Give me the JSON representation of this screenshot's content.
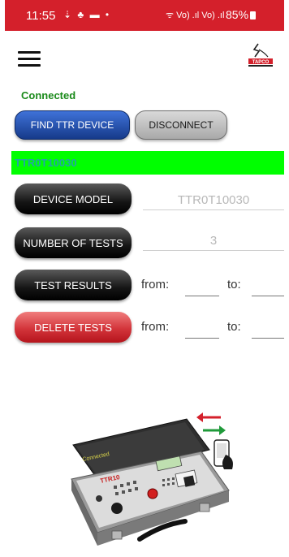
{
  "status_bar": {
    "time": "11:55",
    "notification_icons": "⇣ ♣ ▬ •",
    "signal_text": "ᯤ Vo) .ıl Vo) .ıl",
    "battery_text": "85%"
  },
  "app": {
    "connection_status": "Connected",
    "find_button_label": "FIND TTR DEVICE",
    "disconnect_button_label": "DISCONNECT",
    "device_id_banner": "TTR0T10030",
    "logo_text": "TAPCO"
  },
  "rows": {
    "device_model": {
      "label": "DEVICE MODEL",
      "value": "TTR0T10030"
    },
    "number_of_tests": {
      "label": "NUMBER OF TESTS",
      "value": "3"
    },
    "test_results": {
      "label": "TEST RESULTS",
      "from_label": "from:",
      "to_label": "to:"
    },
    "delete_tests": {
      "label": "DELETE TESTS",
      "from_label": "from:",
      "to_label": "to:"
    }
  },
  "illustration": {
    "screen_text": "Connected",
    "device_label": "TTR10"
  },
  "colors": {
    "status_bar": "#d4202b",
    "connected_text": "#1a8a1a",
    "banner_bg": "#00ff00",
    "banner_text": "#22a3a8",
    "find_button": "#2a55b8",
    "delete_button": "#d3353b"
  }
}
